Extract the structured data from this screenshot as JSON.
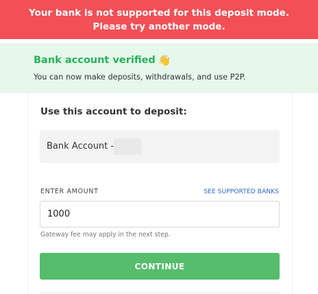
{
  "error_banner": {
    "line1": "Your bank is not supported for this deposit mode.",
    "line2": "Please try another mode.",
    "color": "#f25056"
  },
  "verified": {
    "title": "Bank account verified",
    "icon": "waving-hand-icon",
    "subtitle": "You can now make deposits, withdrawals, and use P2P.",
    "color": "#27b15a"
  },
  "deposit": {
    "heading": "Use this account to deposit:",
    "bank_account_label": "Bank Account -"
  },
  "amount": {
    "label": "ENTER AMOUNT",
    "supported_banks_link": "SEE SUPPORTED BANKS",
    "value": "1000",
    "fee_note": "Gateway fee may apply in the next step."
  },
  "continue_button": {
    "label": "CONTINUE",
    "color": "#55bd6c"
  }
}
